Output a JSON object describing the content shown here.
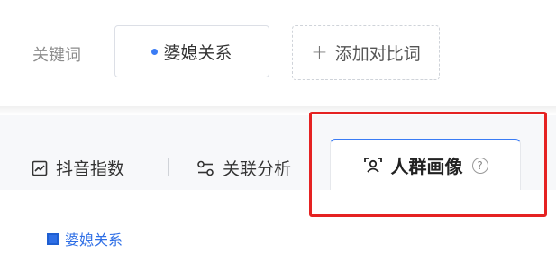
{
  "keyword_section": {
    "label": "关键词",
    "keyword_chip": "婆媳关系",
    "add_compare": "添加对比词",
    "add_compare_plus": "+"
  },
  "tabs": [
    {
      "label": "抖音指数",
      "icon": "trend-chart-icon",
      "active": false
    },
    {
      "label": "关联分析",
      "icon": "link-analysis-icon",
      "active": false
    },
    {
      "label": "人群画像",
      "icon": "crowd-portrait-icon",
      "active": true
    }
  ],
  "help_icon": "?",
  "legend": {
    "label": "婆媳关系"
  },
  "colors": {
    "accent": "#3a7cf5",
    "legend": "#2f6fe6",
    "highlight": "#e52222",
    "tab_bar_bg": "#f7f8fa"
  }
}
